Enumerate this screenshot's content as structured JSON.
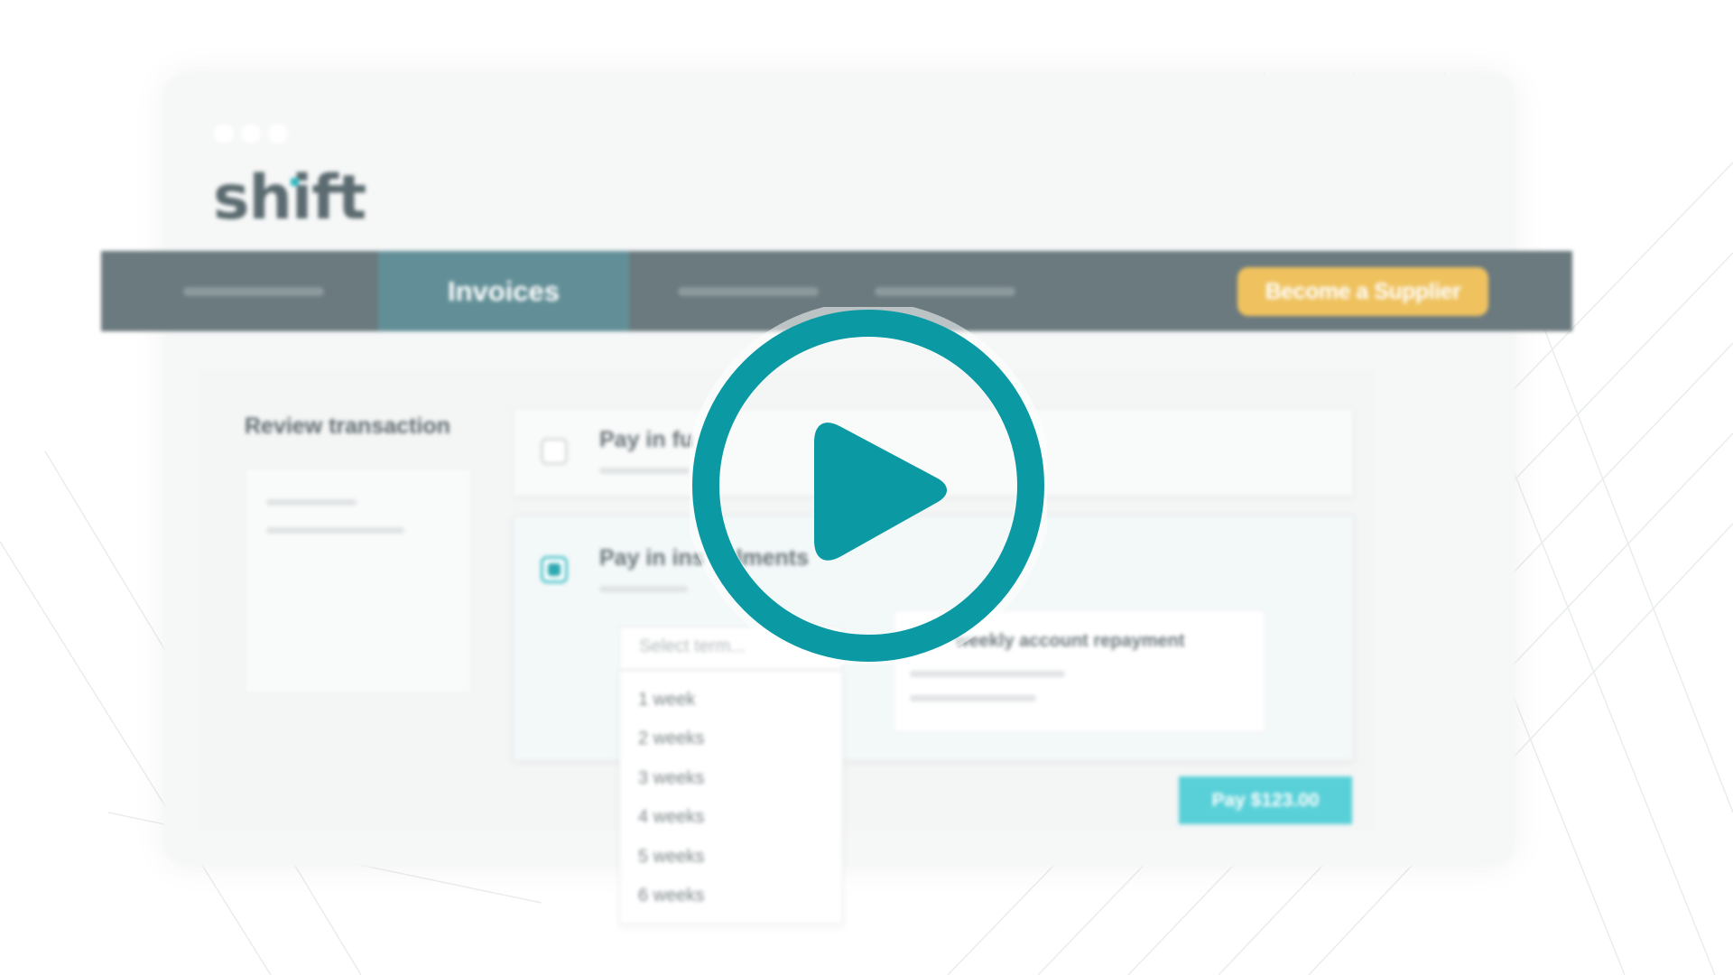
{
  "app": {
    "logo_text": "shift"
  },
  "nav": {
    "active_tab": "Invoices",
    "cta_label": "Become a Supplier"
  },
  "review": {
    "title": "Review transaction"
  },
  "payment": {
    "option_full_label": "Pay in fu",
    "option_installments_label": "Pay in ins     lments",
    "repayment_text": "weekly account repayment",
    "select_placeholder": "Select term...",
    "terms": [
      "1 week",
      "2 weeks",
      "3 weeks",
      "4 weeks",
      "5 weeks",
      "6 weeks"
    ],
    "pay_button_label": "Pay $123.00"
  },
  "colors": {
    "nav_bg": "#6b7a7f",
    "tab_active": "#628f97",
    "cta_yellow": "#efc25f",
    "pay_teal": "#59d0d8",
    "play_teal": "#0b9aa3"
  },
  "icons": {
    "play": "play-circle-icon"
  }
}
